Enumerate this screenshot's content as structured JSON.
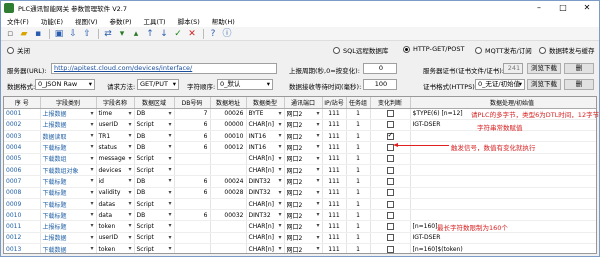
{
  "window": {
    "title": "PLC通讯智能网关 参数管理软件 V2.7"
  },
  "menu": [
    "文件(F)",
    "功能(E)",
    "视图(V)",
    "参数(P)",
    "工具(T)",
    "脚本(S)",
    "帮助(H)"
  ],
  "toolbar_icons": [
    "new-file-icon",
    "open-folder-icon",
    "save-icon",
    "save-as-icon",
    "import-icon",
    "export-icon",
    "connect-icon",
    "read-icon",
    "write-icon",
    "upload-icon",
    "download-icon",
    "check-icon",
    "cancel-icon",
    "help-icon",
    "about-icon"
  ],
  "modes": {
    "off": "关闭",
    "sql": "SQL远程数据库",
    "http": "HTTP-GET/POST",
    "mqtt": "MQTT发布/订阅",
    "forward": "数据转发与缓存"
  },
  "server": {
    "url_label": "服务器(URL):",
    "url_value": "http://apitest.cloud.com/devices/interface/",
    "period_label": "上报周期(秒,0=按变化):",
    "period_value": "0",
    "cert_label": "服务器证书(证书文件/证书):",
    "cert_value": "241",
    "browse_label": "浏览下载",
    "delete_label": "删"
  },
  "format": {
    "label": "数据格式:",
    "value": "0_JSON Raw",
    "method_label": "请求方法:",
    "method_value": "GET/PUT",
    "encoding_label": "字符顺序:",
    "encoding_value": "0_默认",
    "timeout_label": "数据接收等待时间(毫秒):",
    "timeout_value": "100",
    "certfmt_label": "证书格式(HTTPS):",
    "certfmt_value": "0_无证/初始值",
    "browse_label": "浏览下载",
    "delete_label": "删"
  },
  "table": {
    "headers": [
      "序 号",
      "字段类别",
      "字段名称",
      "数据区域",
      "DB号码",
      "数据地址",
      "数据类型",
      "通讯端口",
      "IP/站号",
      "任务组",
      "变化判断",
      "数据处理/初始值"
    ],
    "rows": [
      [
        "0001",
        "上报数据",
        "time",
        "DB",
        "7",
        "00026",
        "BYTE",
        "网口2",
        "111",
        "1",
        "",
        "$TYPE(6) [n=12]"
      ],
      [
        "0002",
        "上报数据",
        "userID",
        "Script",
        "6",
        "00000",
        "CHAR[n]",
        "网口2",
        "111",
        "1",
        "",
        "IGT-DSER"
      ],
      [
        "0003",
        "数据读取",
        "TR1",
        "DB",
        "6",
        "00010",
        "INT16",
        "网口2",
        "111",
        "1",
        "on",
        ""
      ],
      [
        "0004",
        "下载标题",
        "status",
        "DB",
        "6",
        "00012",
        "INT16",
        "网口2",
        "111",
        "1",
        "",
        ""
      ],
      [
        "0005",
        "下载数组",
        "message",
        "Script",
        "",
        "",
        "CHAR[n]",
        "网口2",
        "111",
        "1",
        "",
        ""
      ],
      [
        "0006",
        "下载数组对象",
        "devices",
        "Script",
        "",
        "",
        "CHAR[n]",
        "网口2",
        "111",
        "1",
        "",
        ""
      ],
      [
        "0007",
        "下载标题",
        "id",
        "DB",
        "6",
        "00024",
        "DINT32",
        "网口2",
        "111",
        "1",
        "",
        ""
      ],
      [
        "0008",
        "下载标题",
        "validity",
        "DB",
        "6",
        "00028",
        "DINT32",
        "网口2",
        "111",
        "1",
        "",
        ""
      ],
      [
        "0009",
        "下载标题",
        "datas",
        "Script",
        "",
        "",
        "CHAR[n]",
        "网口2",
        "111",
        "1",
        "",
        ""
      ],
      [
        "0010",
        "下载标题",
        "data",
        "DB",
        "6",
        "00032",
        "DINT32",
        "网口2",
        "111",
        "1",
        "",
        ""
      ],
      [
        "0011",
        "上报标题",
        "token",
        "Script",
        "",
        "",
        "CHAR[n]",
        "网口2",
        "111",
        "1",
        "",
        "[n=160]"
      ],
      [
        "0012",
        "上报数据",
        "userID",
        "Script",
        "",
        "",
        "CHAR[n]",
        "网口2",
        "111",
        "1",
        "",
        "IGT-DSER"
      ],
      [
        "0013",
        "下载数据",
        "token",
        "Script",
        "",
        "",
        "CHAR[n]",
        "网口2",
        "111",
        "1",
        "",
        "[n=160]$(token)"
      ]
    ]
  },
  "annotations": {
    "a1": "请PLC的多字节，类型6为DTL时间，12字节",
    "a2": "字符串常数赋值",
    "a3": "触发信号，数值有变化就执行",
    "a4": "最长字符数限制为160个"
  },
  "colors": {
    "annotation": "#e02020",
    "field_text": "#1f5fa6"
  }
}
